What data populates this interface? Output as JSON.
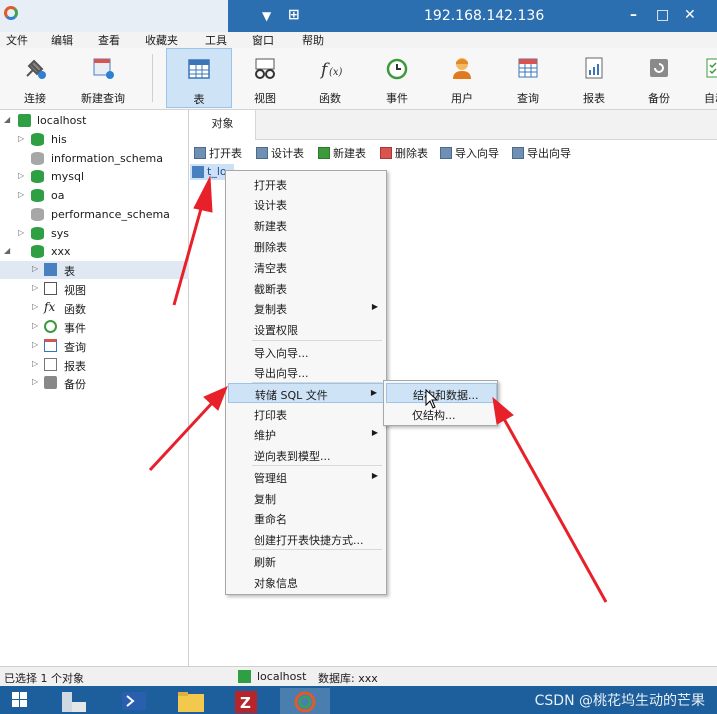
{
  "titlebar": {
    "host": "192.168.142.136",
    "dropdown_icon": "▼",
    "pin_icon": "⊞",
    "minimize": "–",
    "maximize": "□",
    "close": "✕"
  },
  "menubar": [
    "文件",
    "编辑",
    "查看",
    "收藏夹",
    "工具",
    "窗口",
    "帮助"
  ],
  "toolbar": [
    {
      "label": "连接",
      "icon": "plug-icon"
    },
    {
      "label": "新建查询",
      "icon": "new-query-icon"
    },
    {
      "label": "表",
      "icon": "table-icon"
    },
    {
      "label": "视图",
      "icon": "view-icon"
    },
    {
      "label": "函数",
      "icon": "function-icon"
    },
    {
      "label": "事件",
      "icon": "clock-icon"
    },
    {
      "label": "用户",
      "icon": "user-icon"
    },
    {
      "label": "查询",
      "icon": "query-icon"
    },
    {
      "label": "报表",
      "icon": "report-icon"
    },
    {
      "label": "备份",
      "icon": "backup-icon"
    },
    {
      "label": "自动",
      "icon": "automation-icon"
    }
  ],
  "tree": {
    "connection": "localhost",
    "databases": [
      "his",
      "information_schema",
      "mysql",
      "oa",
      "performance_schema",
      "sys",
      "xxx"
    ],
    "xxx_children": [
      "表",
      "视图",
      "函数",
      "事件",
      "查询",
      "报表",
      "备份"
    ]
  },
  "object_tab": "对象",
  "actions": [
    "打开表",
    "设计表",
    "新建表",
    "删除表",
    "导入向导",
    "导出向导"
  ],
  "table_item": "t_lo",
  "context_menu": [
    "打开表",
    "设计表",
    "新建表",
    "删除表",
    "清空表",
    "截断表",
    "复制表",
    "设置权限",
    "导入向导...",
    "导出向导...",
    "转储 SQL 文件",
    "打印表",
    "维护",
    "逆向表到模型...",
    "管理组",
    "复制",
    "重命名",
    "创建打开表快捷方式...",
    "刷新",
    "对象信息"
  ],
  "submenu": [
    "结构和数据...",
    "仅结构..."
  ],
  "statusbar": {
    "selected": "已选择 1 个对象",
    "connection": "localhost",
    "database": "数据库: xxx"
  },
  "watermark": "CSDN @桃花坞生动的芒果",
  "colors": {
    "accent": "#2c6fb0",
    "arrow": "#e8202a",
    "db_green": "#2ea043"
  }
}
